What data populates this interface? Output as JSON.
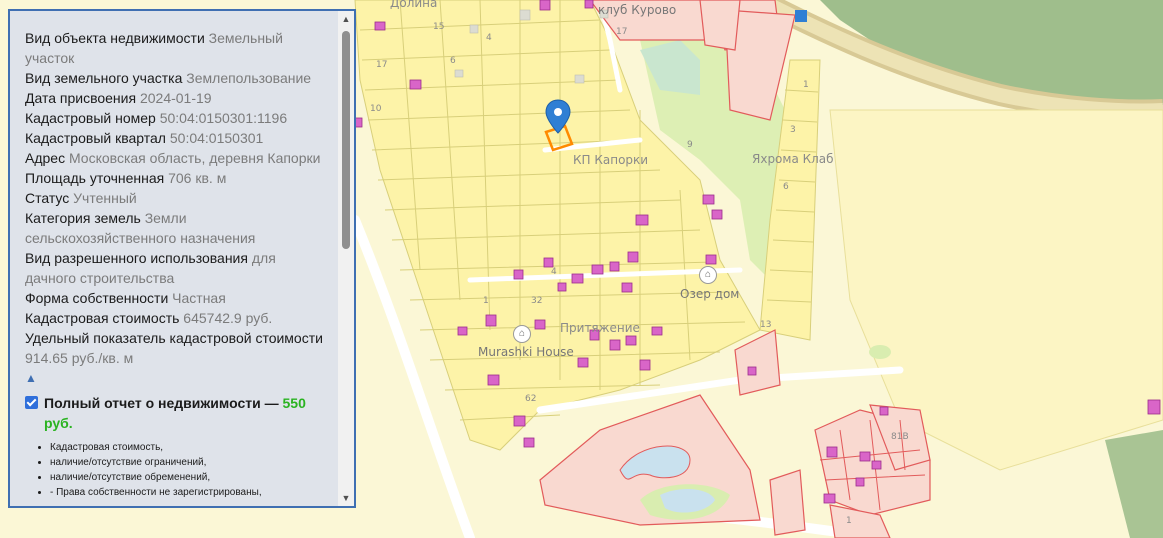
{
  "map": {
    "labels": {
      "dolina": "Долина",
      "klub_kurovo": "клуб Курово",
      "kp_kaporki": "КП Капорки",
      "yakhroma": "Яхрома Клаб",
      "ozer_dom": "Озер дом",
      "murashki": "Murashki House",
      "prityazhenie": "Притяжение"
    },
    "numbers": {
      "n15": "15",
      "n4": "4",
      "n17a": "17",
      "n6": "6",
      "n10": "10",
      "n17b": "17",
      "n1a": "1",
      "n3": "3",
      "n6b": "6",
      "n9": "9",
      "n4b": "4",
      "n1b": "1",
      "n32": "32",
      "n62": "62",
      "n13": "13",
      "n81b": "81В",
      "n1c": "1"
    },
    "colors": {
      "background": "#fbf7d6",
      "parcel_fill": "#fdf3a8",
      "parcel_stroke": "#d8cf7a",
      "building": "#d965c8",
      "red_parcel": "#e25b5b",
      "road": "#ffffff",
      "green": "#c8e6a0",
      "forest": "#9fbe8c",
      "water": "#c9e1ee",
      "highway": "#d8c995",
      "marker": "#2f7fd4",
      "selected": "#ff8a00"
    }
  },
  "panel": {
    "rows": [
      {
        "label": "Вид объекта недвижимости",
        "value": "Земельный участок"
      },
      {
        "label": "Вид земельного участка",
        "value": "Землепользование"
      },
      {
        "label": "Дата присвоения",
        "value": "2024-01-19"
      },
      {
        "label": "Кадастровый номер",
        "value": "50:04:0150301:1196"
      },
      {
        "label": "Кадастровый квартал",
        "value": "50:04:0150301"
      },
      {
        "label": "Адрес",
        "value": "Московская область, деревня Капорки"
      },
      {
        "label": "Площадь уточненная",
        "value": "706 кв. м"
      },
      {
        "label": "Статус",
        "value": "Учтенный"
      },
      {
        "label": "Категория земель",
        "value": "Земли сельскохозяйственного назначения"
      },
      {
        "label": "Вид разрешенного использования",
        "value": "для дачного строительства"
      },
      {
        "label": "Форма собственности",
        "value": "Частная"
      },
      {
        "label": "Кадастровая стоимость",
        "value": "645742.9 руб."
      },
      {
        "label": "Удельный показатель кадастровой стоимости",
        "value": "914.65 руб./кв. м"
      }
    ],
    "collapse_arrow": "▲",
    "report": {
      "checked": true,
      "title": "Полный отчет о недвижимости —",
      "price": "550 руб.",
      "items": [
        "Кадастровая стоимость,",
        "наличие/отсутствие ограничений,",
        "наличие/отсутствие обременений,",
        "- Права собственности не зарегистрированы,"
      ]
    },
    "scroll_up": "▲",
    "scroll_down": "▼"
  }
}
